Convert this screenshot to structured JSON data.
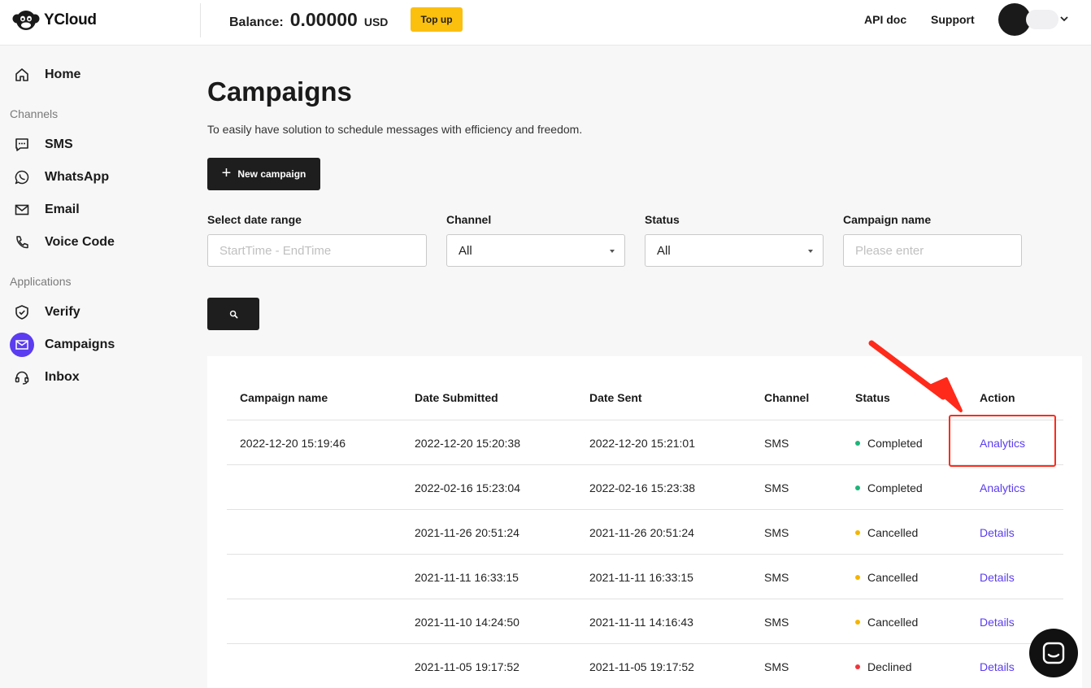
{
  "header": {
    "logo_text": "YCloud",
    "balance_label": "Balance:",
    "balance_value": "0.00000",
    "balance_currency": "USD",
    "topup_label": "Top up",
    "api_doc_label": "API doc",
    "support_label": "Support"
  },
  "sidebar": {
    "home": "Home",
    "channels_section": "Channels",
    "sms": "SMS",
    "whatsapp": "WhatsApp",
    "email": "Email",
    "voice_code": "Voice Code",
    "applications_section": "Applications",
    "verify": "Verify",
    "campaigns": "Campaigns",
    "inbox": "Inbox",
    "active_color": "#5b3cf0"
  },
  "main": {
    "title": "Campaigns",
    "subtitle": "To easily have solution to schedule messages with efficiency and freedom.",
    "new_campaign_label": "New campaign",
    "filters": {
      "date_label": "Select date range",
      "date_placeholder": "StartTime - EndTime",
      "channel_label": "Channel",
      "channel_value": "All",
      "status_label": "Status",
      "status_value": "All",
      "name_label": "Campaign name",
      "name_placeholder": "Please enter"
    }
  },
  "table": {
    "headers": {
      "name": "Campaign name",
      "submitted": "Date Submitted",
      "sent": "Date Sent",
      "channel": "Channel",
      "status": "Status",
      "action": "Action"
    },
    "rows": [
      {
        "name": "2022-12-20 15:19:46",
        "submitted": "2022-12-20 15:20:38",
        "sent": "2022-12-20 15:21:01",
        "channel": "SMS",
        "status": "Completed",
        "status_color": "#1db47a",
        "action": "Analytics"
      },
      {
        "name": "",
        "submitted": "2022-02-16 15:23:04",
        "sent": "2022-02-16 15:23:38",
        "channel": "SMS",
        "status": "Completed",
        "status_color": "#1db47a",
        "action": "Analytics"
      },
      {
        "name": "",
        "submitted": "2021-11-26 20:51:24",
        "sent": "2021-11-26 20:51:24",
        "channel": "SMS",
        "status": "Cancelled",
        "status_color": "#f5b400",
        "action": "Details"
      },
      {
        "name": "",
        "submitted": "2021-11-11 16:33:15",
        "sent": "2021-11-11 16:33:15",
        "channel": "SMS",
        "status": "Cancelled",
        "status_color": "#f5b400",
        "action": "Details"
      },
      {
        "name": "",
        "submitted": "2021-11-10 14:24:50",
        "sent": "2021-11-11 14:16:43",
        "channel": "SMS",
        "status": "Cancelled",
        "status_color": "#f5b400",
        "action": "Details"
      },
      {
        "name": "",
        "submitted": "2021-11-05 19:17:52",
        "sent": "2021-11-05 19:17:52",
        "channel": "SMS",
        "status": "Declined",
        "status_color": "#f0353b",
        "action": "Details"
      }
    ]
  }
}
